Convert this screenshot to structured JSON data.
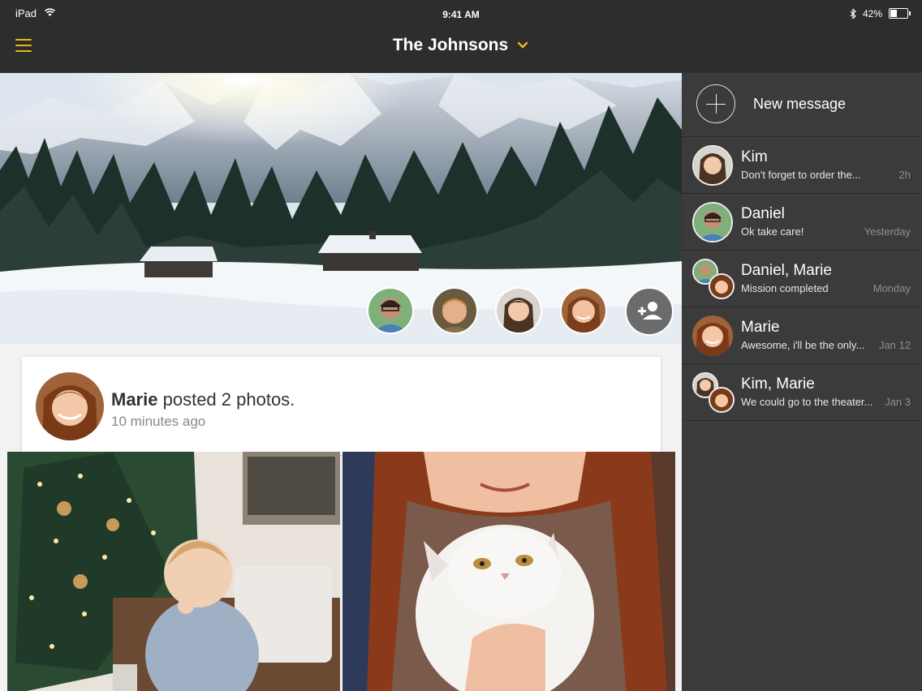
{
  "status_bar": {
    "device": "iPad",
    "time": "9:41 AM",
    "battery_percent": "42%",
    "battery_level": 0.42
  },
  "nav": {
    "title": "The Johnsons",
    "menu_icon": "hamburger-icon",
    "dropdown_icon": "chevron-down-icon"
  },
  "colors": {
    "accent": "#e8b91a",
    "bar_bg": "#2d2d2d",
    "sidebar_bg": "#3b3b3b",
    "feed_bg": "#f2f2f2"
  },
  "hero": {
    "add_member_icon": "person-add-icon"
  },
  "post": {
    "author": "Marie",
    "action": "posted 2 photos.",
    "time": "10 minutes ago"
  },
  "sidebar": {
    "new_message": "New message",
    "conversations": [
      {
        "name": "Kim",
        "preview": "Don't forget to order the...",
        "time": "2h"
      },
      {
        "name": "Daniel",
        "preview": "Ok take care!",
        "time": "Yesterday"
      },
      {
        "name": "Daniel, Marie",
        "preview": "Mission completed",
        "time": "Monday"
      },
      {
        "name": "Marie",
        "preview": "Awesome, i'll be the only...",
        "time": "Jan 12"
      },
      {
        "name": "Kim, Marie",
        "preview": "We could go to the theater...",
        "time": "Jan 3"
      }
    ]
  }
}
